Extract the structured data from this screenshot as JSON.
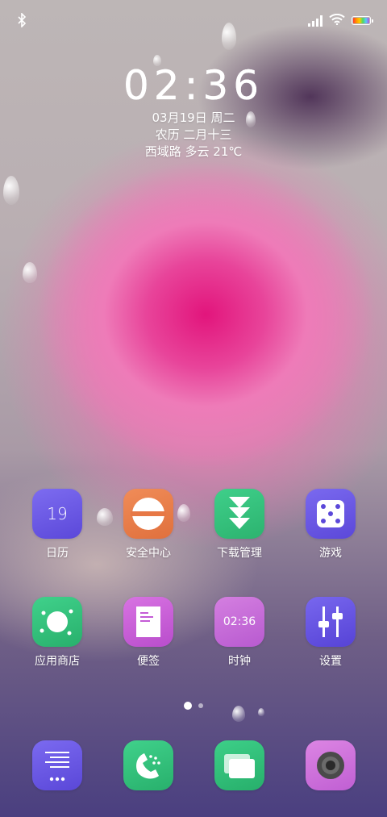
{
  "status_bar": {
    "bluetooth_icon": "bluetooth-icon",
    "signal_icon": "signal-icon",
    "wifi_icon": "wifi-icon",
    "battery_icon": "battery-icon"
  },
  "clock": {
    "time": "02:36",
    "date": "03月19日 周二",
    "lunar": "农历 二月十三",
    "weather": "西域路 多云 21℃"
  },
  "apps_row1": [
    {
      "label": "日历",
      "icon": "calendar-icon",
      "icon_text": "19",
      "color": "#6c5ce7"
    },
    {
      "label": "安全中心",
      "icon": "security-center-icon",
      "color": "#e8814d"
    },
    {
      "label": "下载管理",
      "icon": "download-manager-icon",
      "color": "#37c07d"
    },
    {
      "label": "游戏",
      "icon": "game-dice-icon",
      "color": "#6b5ae6"
    }
  ],
  "apps_row2": [
    {
      "label": "应用商店",
      "icon": "app-store-icon",
      "color": "#33c47e"
    },
    {
      "label": "便签",
      "icon": "notes-icon",
      "color": "#c85bd6"
    },
    {
      "label": "时钟",
      "icon": "clock-icon",
      "icon_text": "02:36",
      "color": "#c666d8"
    },
    {
      "label": "设置",
      "icon": "settings-icon",
      "color": "#6b57e5"
    }
  ],
  "dock": [
    {
      "icon": "more-apps-icon",
      "color": "#6d5ae8"
    },
    {
      "icon": "phone-icon",
      "color": "#34c27e"
    },
    {
      "icon": "messages-icon",
      "color": "#32be7a"
    },
    {
      "icon": "camera-icon",
      "color": "#d16fd9"
    }
  ],
  "page_indicator": {
    "pages": 2,
    "current": 1
  }
}
